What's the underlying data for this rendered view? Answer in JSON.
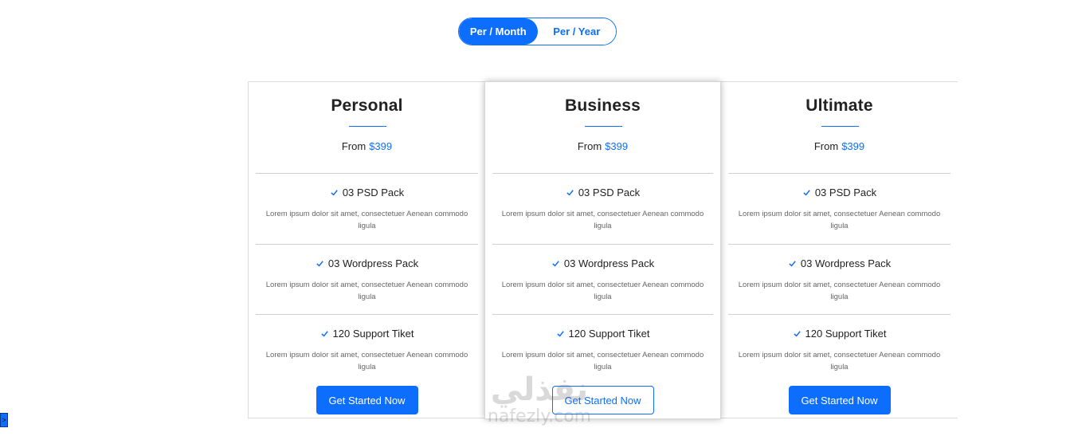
{
  "billing_toggle": {
    "options": [
      {
        "label": "Per / Month",
        "active": true
      },
      {
        "label": "Per / Year",
        "active": false
      }
    ]
  },
  "plans": [
    {
      "name": "Personal",
      "price_prefix": "From",
      "price": "$399",
      "features": [
        {
          "title": "03 PSD Pack",
          "desc": "Lorem ipsum dolor sit amet, consectetuer Aenean commodo ligula"
        },
        {
          "title": "03 Wordpress Pack",
          "desc": "Lorem ipsum dolor sit amet, consectetuer Aenean commodo ligula"
        },
        {
          "title": "120 Support Tiket",
          "desc": "Lorem ipsum dolor sit amet, consectetuer Aenean commodo ligula"
        }
      ],
      "cta": "Get Started Now"
    },
    {
      "name": "Business",
      "price_prefix": "From",
      "price": "$399",
      "features": [
        {
          "title": "03 PSD Pack",
          "desc": "Lorem ipsum dolor sit amet, consectetuer Aenean commodo ligula"
        },
        {
          "title": "03 Wordpress Pack",
          "desc": "Lorem ipsum dolor sit amet, consectetuer Aenean commodo ligula"
        },
        {
          "title": "120 Support Tiket",
          "desc": "Lorem ipsum dolor sit amet, consectetuer Aenean commodo ligula"
        }
      ],
      "cta": "Get Started Now"
    },
    {
      "name": "Ultimate",
      "price_prefix": "From",
      "price": "$399",
      "features": [
        {
          "title": "03 PSD Pack",
          "desc": "Lorem ipsum dolor sit amet, consectetuer Aenean commodo ligula"
        },
        {
          "title": "03 Wordpress Pack",
          "desc": "Lorem ipsum dolor sit amet, consectetuer Aenean commodo ligula"
        },
        {
          "title": "120 Support Tiket",
          "desc": "Lorem ipsum dolor sit amet, consectetuer Aenean commodo ligula"
        }
      ],
      "cta": "Get Started Now"
    }
  ],
  "icons": {
    "feature_check": "check-icon",
    "corner_tab": "chevron-right-icon"
  },
  "colors": {
    "accent": "#0d6efd",
    "border": "#dcdcdc"
  },
  "corner_tab_glyph": ">",
  "watermark": {
    "arabic": "نفذلي",
    "latin": "nafezly.com"
  }
}
